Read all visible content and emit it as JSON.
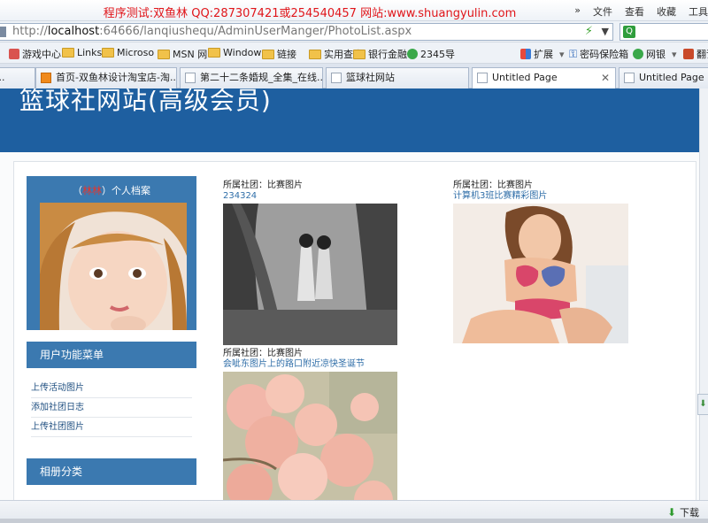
{
  "window": {
    "title": "程序测试:双鱼林 QQ:287307421或254540457 网站:www.shuangyulin.com",
    "menu": [
      "文件",
      "查看",
      "收藏",
      "工具"
    ]
  },
  "address": {
    "prefix": "http://",
    "host": "localhost",
    "rest": ":64666/lanqiushequ/AdminUserManger/PhotoList.aspx"
  },
  "favorites": {
    "items": [
      "游戏中心",
      "Links",
      "Microso",
      "MSN 网",
      "Window",
      "链接",
      "实用查询",
      "银行金融",
      "2345导"
    ],
    "extras": [
      "扩展",
      "密码保险箱",
      "网银",
      "翻译"
    ]
  },
  "tabs": [
    {
      "label": "首页-双鱼林设计淘宝店-淘..."
    },
    {
      "label": "第二十二条婚规_全集_在线..."
    },
    {
      "label": "篮球社网站"
    },
    {
      "label": "Untitled Page"
    },
    {
      "label": "Untitled Page"
    }
  ],
  "page": {
    "banner_title": "篮球社网站(高级会员)",
    "profile": {
      "open": "（",
      "username": "林林",
      "close": "）个人档案"
    },
    "menu_header": "用户功能菜单",
    "menu_links": [
      "上传活动图片",
      "添加社团日志",
      "上传社团图片"
    ],
    "album_header": "相册分类",
    "photos": [
      {
        "club": "所属社团：比赛图片",
        "title": "234324"
      },
      {
        "club": "所属社团：比赛图片",
        "title": "计算机3班比赛精彩图片"
      },
      {
        "club": "所属社团：比赛图片",
        "title": "会呲东图片上的路口附近凉快圣诞节"
      }
    ]
  },
  "statusbar": {
    "download_label": "下载"
  }
}
